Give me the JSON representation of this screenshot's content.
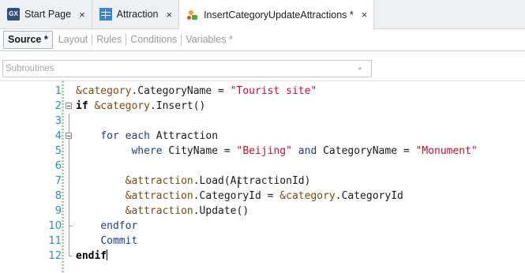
{
  "tabs": [
    {
      "label": "Start Page",
      "icon": "gx-icon",
      "icon_text": "GX"
    },
    {
      "label": "Attraction",
      "icon": "transaction-grid-icon"
    },
    {
      "label": "InsertCategoryUpdateAttractions *",
      "icon": "procedure-icon",
      "active": true
    }
  ],
  "tab_close_glyph": "×",
  "parts": [
    {
      "label": "Source *",
      "active": true
    },
    {
      "label": "Layout"
    },
    {
      "label": "Rules"
    },
    {
      "label": "Conditions"
    },
    {
      "label": "Variables *"
    }
  ],
  "subroutines": {
    "value": "Subroutines"
  },
  "editor": {
    "lines": [
      {
        "n": "1",
        "tokens": [
          [
            "var",
            "&category"
          ],
          [
            "plain",
            ".CategoryName = "
          ],
          [
            "str",
            "\"Tourist site\""
          ]
        ]
      },
      {
        "n": "2",
        "tokens": [
          [
            "kwb",
            "if"
          ],
          [
            "plain",
            " "
          ],
          [
            "var",
            "&category"
          ],
          [
            "plain",
            ".Insert()"
          ]
        ]
      },
      {
        "n": "3",
        "tokens": []
      },
      {
        "n": "4",
        "tokens": [
          [
            "plain",
            "    "
          ],
          [
            "kw",
            "for each"
          ],
          [
            "plain",
            " Attraction"
          ]
        ]
      },
      {
        "n": "5",
        "tokens": [
          [
            "plain",
            "         "
          ],
          [
            "kw",
            "where"
          ],
          [
            "plain",
            " CityName = "
          ],
          [
            "str",
            "\"Beijing\""
          ],
          [
            "plain",
            " "
          ],
          [
            "kw",
            "and"
          ],
          [
            "plain",
            " CategoryName = "
          ],
          [
            "str",
            "\"Monument\""
          ]
        ]
      },
      {
        "n": "6",
        "tokens": []
      },
      {
        "n": "7",
        "tokens": [
          [
            "plain",
            "        "
          ],
          [
            "var",
            "&attraction"
          ],
          [
            "plain",
            ".Load(AttractionId)"
          ]
        ]
      },
      {
        "n": "8",
        "tokens": [
          [
            "plain",
            "        "
          ],
          [
            "var",
            "&attraction"
          ],
          [
            "plain",
            ".CategoryId = "
          ],
          [
            "var",
            "&category"
          ],
          [
            "plain",
            ".CategoryId"
          ]
        ]
      },
      {
        "n": "9",
        "tokens": [
          [
            "plain",
            "        "
          ],
          [
            "var",
            "&attraction"
          ],
          [
            "plain",
            ".Update()"
          ]
        ]
      },
      {
        "n": "10",
        "tokens": [
          [
            "plain",
            "    "
          ],
          [
            "kw",
            "endfor"
          ]
        ]
      },
      {
        "n": "11",
        "tokens": [
          [
            "plain",
            "    "
          ],
          [
            "kw",
            "Commit"
          ]
        ]
      },
      {
        "n": "12",
        "tokens": [
          [
            "kwb",
            "endif"
          ]
        ]
      }
    ]
  },
  "colors": {
    "line_number": "#2b91af",
    "variable": "#7a4a10",
    "keyword": "#1f3c8a",
    "string": "#c8102e"
  }
}
